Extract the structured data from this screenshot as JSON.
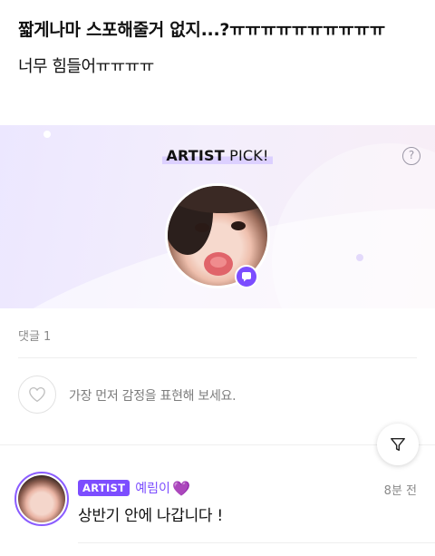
{
  "post": {
    "line1": "짧게나마 스포해줄거 없지...?ㅠㅠㅠㅠㅠㅠㅠㅠㅠㅠ",
    "line2": "너무 힘들어ㅠㅠㅠㅠ"
  },
  "artist_pick": {
    "title_artist": "ARTIST",
    "title_pick": " PICK!",
    "help_glyph": "?",
    "avatar_icon": "artist-profile-photo",
    "badge_icon": "chat-bubble-icon"
  },
  "comments_section": {
    "count_label": "댓글 1",
    "reaction_prompt": "가장 먼저 감정을 표현해 보세요.",
    "heart_icon": "heart-outline-icon",
    "filter_icon": "filter-icon"
  },
  "comments": [
    {
      "badge": "ARTIST",
      "author": "예림이",
      "author_emoji": "💜",
      "time": "8분 전",
      "text": "상반기 안에 나갑니다 !"
    }
  ],
  "colors": {
    "accent": "#7c4dff",
    "muted": "#8a8a8a"
  }
}
